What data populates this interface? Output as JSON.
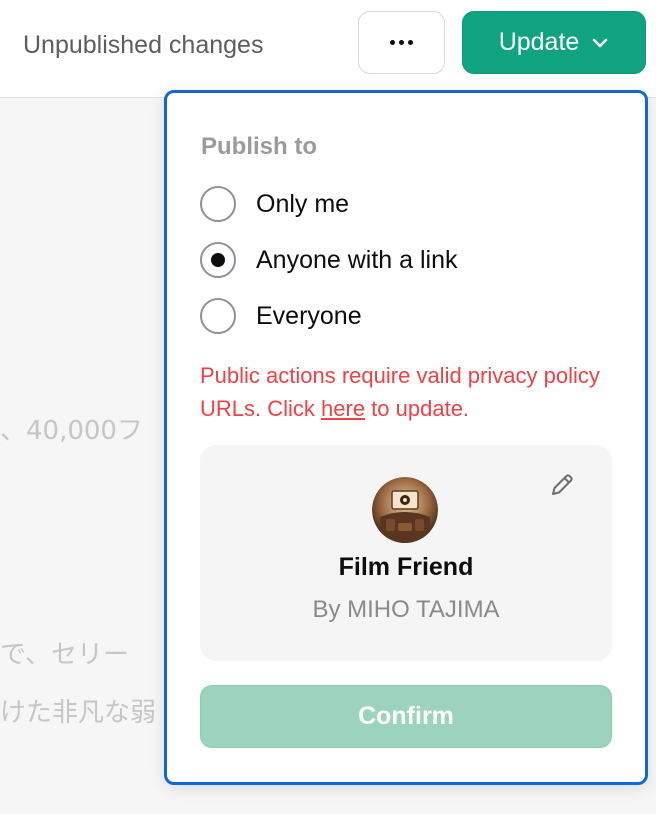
{
  "header": {
    "status": "Unpublished changes",
    "more_icon": "more-horizontal-icon",
    "update_label": "Update",
    "update_icon": "chevron-down-icon",
    "accent_color": "#10a37f"
  },
  "background": {
    "line1": "、40,000フ",
    "line2": "で、セリー",
    "line3": "けた非凡な弱"
  },
  "publish": {
    "heading": "Publish to",
    "options": [
      {
        "label": "Only me",
        "selected": false
      },
      {
        "label": "Anyone with a link",
        "selected": true
      },
      {
        "label": "Everyone",
        "selected": false
      }
    ],
    "warning_before": "Public actions require valid privacy policy URLs. Click ",
    "warning_link": "here",
    "warning_after": " to update.",
    "warning_color": "#ef4146"
  },
  "gpt_card": {
    "edit_icon": "pencil-icon",
    "avatar": "film-theater-avatar",
    "name": "Film Friend",
    "author": "By MIHO TAJIMA"
  },
  "confirm_label": "Confirm"
}
